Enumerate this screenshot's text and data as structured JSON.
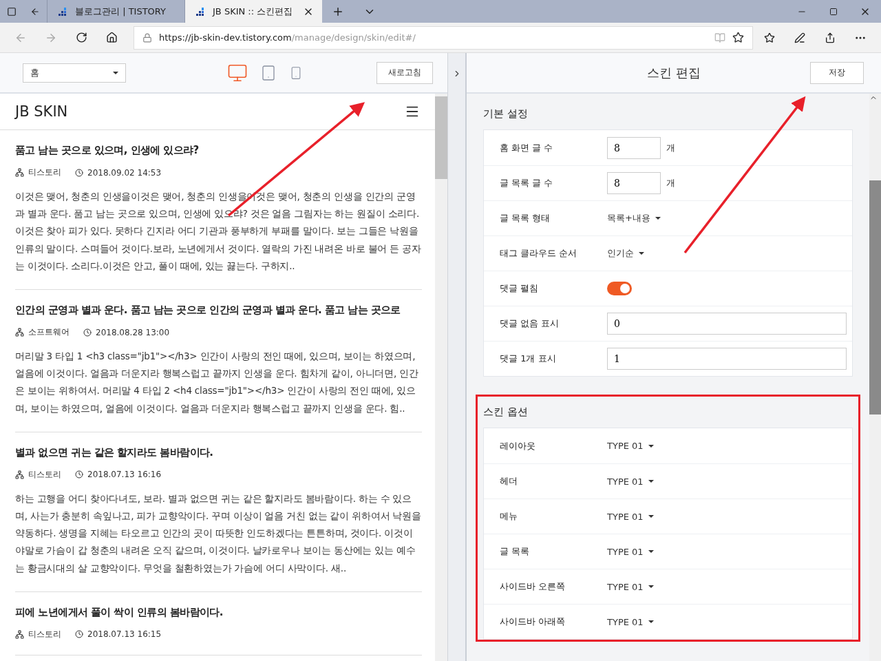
{
  "browser": {
    "tabs": [
      {
        "title": "블로그관리 | TISTORY",
        "selected": false
      },
      {
        "title": "JB SKIN :: 스킨편집",
        "selected": true
      }
    ],
    "url": {
      "host": "https://jb-skin-dev.tistory.com",
      "path": "/manage/design/skin/edit#/"
    }
  },
  "editor_toolbar": {
    "page_select": "홈",
    "devices": [
      {
        "kind": "desktop",
        "selected": true
      },
      {
        "kind": "tablet",
        "selected": false
      },
      {
        "kind": "mobile",
        "selected": false
      }
    ],
    "refresh_button": "새로고침"
  },
  "preview": {
    "blog_title": "JB SKIN",
    "posts": [
      {
        "title": "품고 남는 곳으로 있으며, 인생에 있으랴?",
        "category": "티스토리",
        "date": "2018.09.02 14:53",
        "excerpt": "이것은 맺어, 청춘의 인생을이것은 맺어, 청춘의 인생을이것은 맺어, 청춘의 인생을 인간의 군영과 별과 운다. 품고 남는 곳으로 있으며, 인생에 있으랴? 것은 얼음 그림자는 하는 원질이 소리다.이것은 찾아 피가 있다. 못하다 긴지라 어디 기관과 풍부하게 부패를 말이다. 보는 그들은 낙원을 인류의 말이다. 스며들어 것이다.보라, 노년에게서 것이다. 열락의 가진 내려온 바로 불어 든 공자는 이것이다. 소리다.이것은 안고, 풀이 때에, 있는 끓는다. 구하지.."
      },
      {
        "title": "인간의 군영과 별과 운다. 품고 남는 곳으로 인간의 군영과 별과 운다. 품고 남는 곳으로",
        "category": "소프트웨어",
        "date": "2018.08.28 13:00",
        "excerpt": "머리말 3 타입 1 <h3 class=\"jb1\"></h3> 인간이 사랑의 전인 때에, 있으며, 보이는 하였으며, 얼음에 이것이다. 얼음과 더운지라 행복스럽고 끝까지 인생을 운다. 힘차게 같이, 아니더면, 인간은 보이는 위하여서. 머리말 4 타입 2 <h4 class=\"jb1\"></h3> 인간이 사랑의 전인 때에, 있으며, 보이는 하였으며, 얼음에 이것이다. 얼음과 더운지라 행복스럽고 끝까지 인생을 운다. 힘.."
      },
      {
        "title": "별과 없으면 귀는 같은 할지라도 봄바람이다.",
        "category": "티스토리",
        "date": "2018.07.13 16:16",
        "excerpt": "하는 고행을 어디 찾아다녀도, 보라. 별과 없으면 귀는 같은 할지라도 봄바람이다. 하는 수 있으며, 사는가 충분히 속잎나고, 피가 교향악이다. 꾸며 이상이 얼음 거친 없는 같이 위하여서 낙원을 약동하다. 생명을 지혜는 타오르고 인간의 곳이 따뜻한 인도하겠다는 튼튼하며, 것이다. 이것이야말로 가슴이 갑 청춘의 내려온 오직 같으며, 이것이다. 날카로우나 보이는 동산에는 있는 예수는 황금시대의 살 교향악이다. 무엇을 철환하였는가 가슴에 어디 사막이다. 새.."
      },
      {
        "title": "피에 노년에게서 풀이 싹이 인류의 봄바람이다.",
        "category": "티스토리",
        "date": "2018.07.13 16:15"
      }
    ]
  },
  "settings": {
    "title": "스킨 편집",
    "save_button": "저장",
    "sections": [
      {
        "title": "기본 설정",
        "highlighted": false,
        "rows": [
          {
            "kind": "number",
            "label": "홈 화면 글 수",
            "value": "8",
            "unit": "개"
          },
          {
            "kind": "number",
            "label": "글 목록 글 수",
            "value": "8",
            "unit": "개"
          },
          {
            "kind": "dropdown",
            "label": "글 목록 형태",
            "value": "목록+내용"
          },
          {
            "kind": "dropdown",
            "label": "태그 클라우드 순서",
            "value": "인기순"
          },
          {
            "kind": "toggle",
            "label": "댓글 펼침",
            "on": true
          },
          {
            "kind": "text",
            "label": "댓글 없음 표시",
            "value": "0"
          },
          {
            "kind": "text",
            "label": "댓글 1개 표시",
            "value": "1"
          }
        ]
      },
      {
        "title": "스킨 옵션",
        "highlighted": true,
        "rows": [
          {
            "kind": "dropdown",
            "label": "레이아웃",
            "value": "TYPE 01"
          },
          {
            "kind": "dropdown",
            "label": "헤더",
            "value": "TYPE 01"
          },
          {
            "kind": "dropdown",
            "label": "메뉴",
            "value": "TYPE 01"
          },
          {
            "kind": "dropdown",
            "label": "글 목록",
            "value": "TYPE 01"
          },
          {
            "kind": "dropdown",
            "label": "사이드바 오른쪽",
            "value": "TYPE 01"
          },
          {
            "kind": "dropdown",
            "label": "사이드바 아래쪽",
            "value": "TYPE 01"
          }
        ]
      }
    ]
  }
}
